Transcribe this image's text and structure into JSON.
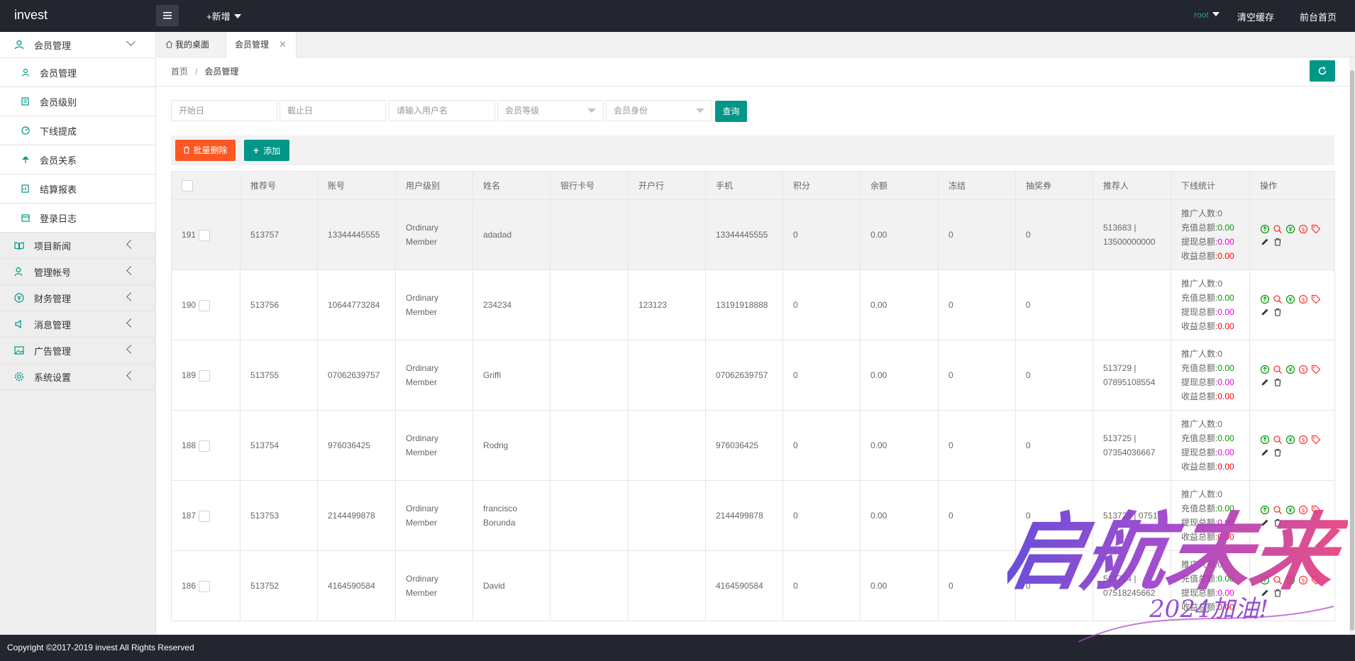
{
  "header": {
    "logo": "invest",
    "new_label": "+新增",
    "user": "root",
    "clear_cache": "清空缓存",
    "front_home": "前台首页"
  },
  "sidebar": {
    "groups": [
      {
        "label": "会员管理",
        "icon": "user-icon"
      },
      {
        "label": "项目新闻",
        "icon": "book-icon"
      },
      {
        "label": "管理帐号",
        "icon": "users-icon"
      },
      {
        "label": "财务管理",
        "icon": "yen-icon"
      },
      {
        "label": "消息管理",
        "icon": "speaker-icon"
      },
      {
        "label": "广告管理",
        "icon": "image-icon"
      },
      {
        "label": "系统设置",
        "icon": "gear-icon"
      }
    ],
    "items": [
      {
        "label": "会员管理"
      },
      {
        "label": "会员级别"
      },
      {
        "label": "下线提成"
      },
      {
        "label": "会员关系"
      },
      {
        "label": "结算报表"
      },
      {
        "label": "登录日志"
      }
    ]
  },
  "tabs": {
    "home": "我的桌面",
    "active": "会员管理",
    "close": "✕"
  },
  "breadcrumb": {
    "home": "首页",
    "sep": "/",
    "current": "会员管理"
  },
  "filters": {
    "start_date": "开始日",
    "end_date": "截止日",
    "username": "请输入用户名",
    "level": "会员等级",
    "identity": "会员身份",
    "search": "查询"
  },
  "toolbar": {
    "batch_delete": "批量删除",
    "add": "添加"
  },
  "table": {
    "headers": [
      "推荐号",
      "账号",
      "用户级别",
      "姓名",
      "银行卡号",
      "开户行",
      "手机",
      "积分",
      "余额",
      "冻结",
      "抽奖券",
      "推荐人",
      "下线统计",
      "操作"
    ],
    "stat_labels": {
      "promoted": "推广人数:",
      "recharge": "充值总额:",
      "withdraw": "提现总额:",
      "income": "收益总额:"
    },
    "rows": [
      {
        "id": "191",
        "ref": "513757",
        "account": "13344445555",
        "level": "Ordinary Member",
        "name": "adadad",
        "bank_card": "",
        "bank": "",
        "phone": "13344445555",
        "points": "0",
        "balance": "0.00",
        "frozen": "0",
        "coupons": "0",
        "referrer": "513683 | 13500000000",
        "promoted": "0",
        "recharge": "0.00",
        "withdraw": "0.00",
        "income": "0.00"
      },
      {
        "id": "190",
        "ref": "513756",
        "account": "10644773284",
        "level": "Ordinary Member",
        "name": "234234",
        "bank_card": "",
        "bank": "123123",
        "phone": "13191918888",
        "points": "0",
        "balance": "0.00",
        "frozen": "0",
        "coupons": "0",
        "referrer": "",
        "promoted": "0",
        "recharge": "0.00",
        "withdraw": "0.00",
        "income": "0.00"
      },
      {
        "id": "189",
        "ref": "513755",
        "account": "07062639757",
        "level": "Ordinary Member",
        "name": "Griffi",
        "bank_card": "",
        "bank": "",
        "phone": "07062639757",
        "points": "0",
        "balance": "0.00",
        "frozen": "0",
        "coupons": "0",
        "referrer": "513729 | 07895108554",
        "promoted": "0",
        "recharge": "0.00",
        "withdraw": "0.00",
        "income": "0.00"
      },
      {
        "id": "188",
        "ref": "513754",
        "account": "976036425",
        "level": "Ordinary Member",
        "name": "Rodrig",
        "bank_card": "",
        "bank": "",
        "phone": "976036425",
        "points": "0",
        "balance": "0.00",
        "frozen": "0",
        "coupons": "0",
        "referrer": "513725 | 07354036667",
        "promoted": "0",
        "recharge": "0.00",
        "withdraw": "0.00",
        "income": "0.00"
      },
      {
        "id": "187",
        "ref": "513753",
        "account": "2144499878",
        "level": "Ordinary Member",
        "name": "francisco Borunda",
        "bank_card": "",
        "bank": "",
        "phone": "2144499878",
        "points": "0",
        "balance": "0.00",
        "frozen": "0",
        "coupons": "0",
        "referrer": "513723 | 0751",
        "promoted": "0",
        "recharge": "0.00",
        "withdraw": "0.00",
        "income": "0.00"
      },
      {
        "id": "186",
        "ref": "513752",
        "account": "4164590584",
        "level": "Ordinary Member",
        "name": "David",
        "bank_card": "",
        "bank": "",
        "phone": "4164590584",
        "points": "0",
        "balance": "0.00",
        "frozen": "0",
        "coupons": "0",
        "referrer": "513724 | 07518245662",
        "promoted": "0",
        "recharge": "0.00",
        "withdraw": "0.00",
        "income": "0.00"
      }
    ]
  },
  "footer": {
    "copyright": "Copyright ©2017-2019 invest All Rights Reserved"
  },
  "watermark": {
    "text": "启航未来",
    "subtext": "2024加油!"
  },
  "colors": {
    "header_bg": "#23262e",
    "accent": "#009688",
    "danger": "#ff5722",
    "recharge": "#009900",
    "withdraw": "#e100e1",
    "income": "#ff0000"
  }
}
